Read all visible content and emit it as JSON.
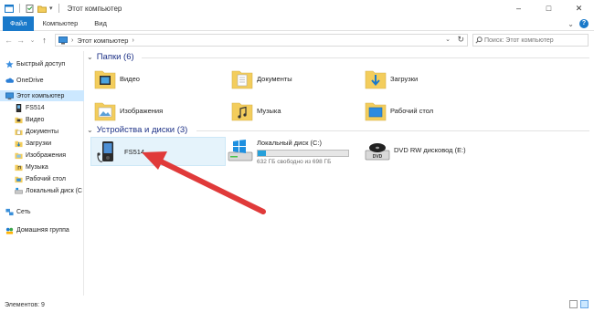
{
  "window": {
    "title": "Этот компьютер",
    "controls": [
      "–",
      "□",
      "✕"
    ]
  },
  "ribbon": {
    "tabs": [
      "Файл",
      "Компьютер",
      "Вид"
    ],
    "expand": "⌄",
    "help": "?"
  },
  "address": {
    "back": "←",
    "forward": "→",
    "recent": "⌄",
    "up": "↑",
    "path": "Этот компьютер",
    "separator": "›",
    "dropdown": "⌄",
    "refresh": "↻",
    "search_placeholder": "Поиск: Этот компьютер"
  },
  "nav": {
    "items": [
      {
        "label": "Быстрый доступ",
        "icon": "star-icon"
      },
      {
        "label": "OneDrive",
        "icon": "cloud-icon"
      },
      {
        "label": "Этот компьютер",
        "icon": "monitor-icon",
        "selected": true
      },
      {
        "label": "FS514",
        "icon": "device-icon"
      },
      {
        "label": "Видео",
        "icon": "video-folder-icon"
      },
      {
        "label": "Документы",
        "icon": "documents-folder-icon"
      },
      {
        "label": "Загрузки",
        "icon": "downloads-folder-icon"
      },
      {
        "label": "Изображения",
        "icon": "pictures-folder-icon"
      },
      {
        "label": "Музыка",
        "icon": "music-folder-icon"
      },
      {
        "label": "Рабочий стол",
        "icon": "desktop-folder-icon"
      },
      {
        "label": "Локальный диск (C",
        "icon": "drive-icon"
      },
      {
        "label": "Сеть",
        "icon": "network-icon"
      },
      {
        "label": "Домашняя группа",
        "icon": "homegroup-icon"
      }
    ]
  },
  "folders": {
    "heading": "Папки (6)",
    "items": [
      {
        "label": "Видео",
        "icon": "video-folder-icon"
      },
      {
        "label": "Документы",
        "icon": "documents-folder-icon"
      },
      {
        "label": "Загрузки",
        "icon": "downloads-folder-icon"
      },
      {
        "label": "Изображения",
        "icon": "pictures-folder-icon"
      },
      {
        "label": "Музыка",
        "icon": "music-folder-icon"
      },
      {
        "label": "Рабочий стол",
        "icon": "desktop-folder-icon"
      }
    ]
  },
  "devices": {
    "heading": "Устройства и диски (3)",
    "items": [
      {
        "label": "FS514",
        "icon": "media-player-icon",
        "selected": true
      },
      {
        "label": "Локальный диск (C:)",
        "icon": "windows-drive-icon",
        "free": "632 ГБ свободно из 698 ГБ",
        "used_fraction": 0.09
      },
      {
        "label": "DVD RW дисковод (E:)",
        "icon": "dvd-drive-icon"
      }
    ]
  },
  "status": {
    "text": "Элементов: 9"
  },
  "colors": {
    "accent": "#1979ca",
    "heading": "#1e3287",
    "selection": "#cce8ff",
    "annotation_arrow": "#e03a3a"
  }
}
